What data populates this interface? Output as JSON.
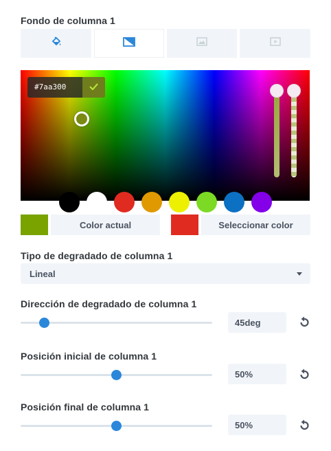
{
  "background_section": {
    "title": "Fondo de columna 1",
    "tabs": [
      {
        "icon": "paint-bucket-icon",
        "active": false
      },
      {
        "icon": "gradient-icon",
        "active": true
      },
      {
        "icon": "image-icon",
        "active": false
      },
      {
        "icon": "video-icon",
        "active": false
      }
    ]
  },
  "color_picker": {
    "hex_value": "#7aa300",
    "selected_color": "#7aa300",
    "swatches": [
      "#000000",
      "#ffffff",
      "#e02b20",
      "#e09900",
      "#edf000",
      "#7cda24",
      "#0c71c3",
      "#8300e9"
    ],
    "current_color_label": "Color actual",
    "current_color": "#7aa300",
    "select_color_label": "Seleccionar color",
    "select_color": "#e02b20"
  },
  "gradient_type": {
    "label": "Tipo de degradado de columna 1",
    "value": "Lineal"
  },
  "gradient_direction": {
    "label": "Dirección de degradado de columna 1",
    "value": "45deg",
    "fraction": 0.125
  },
  "start_position": {
    "label": "Posición inicial de columna 1",
    "value": "50%",
    "fraction": 0.5
  },
  "end_position": {
    "label": "Posición final de columna 1",
    "value": "50%",
    "fraction": 0.5
  },
  "colors": {
    "accent": "#2b87da",
    "field_bg": "#f1f5f9"
  }
}
